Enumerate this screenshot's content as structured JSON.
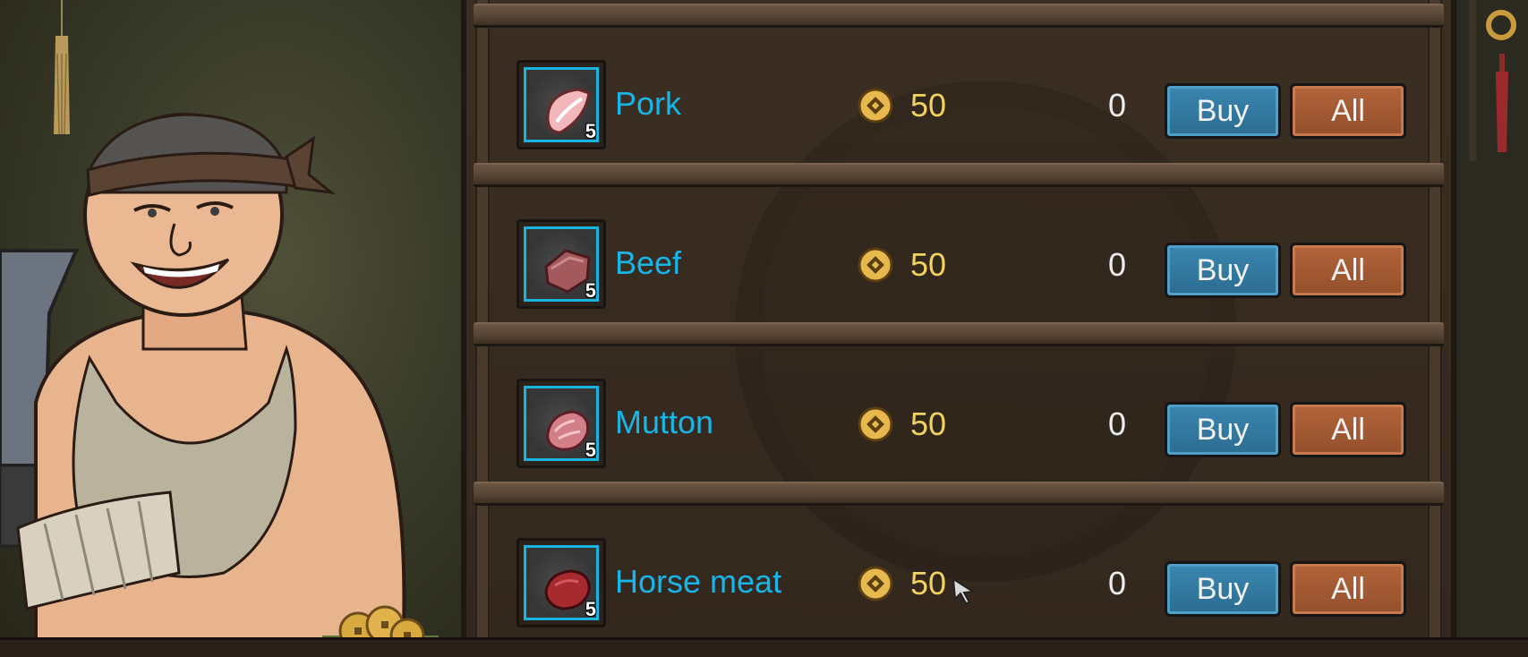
{
  "shop": {
    "items": [
      {
        "name": "Pork",
        "quantity": "5",
        "price": "50",
        "owned": "0",
        "buy_label": "Buy",
        "all_label": "All",
        "icon": "pork-icon",
        "color": "#f1b7ba"
      },
      {
        "name": "Beef",
        "quantity": "5",
        "price": "50",
        "owned": "0",
        "buy_label": "Buy",
        "all_label": "All",
        "icon": "beef-icon",
        "color": "#a4595d"
      },
      {
        "name": "Mutton",
        "quantity": "5",
        "price": "50",
        "owned": "0",
        "buy_label": "Buy",
        "all_label": "All",
        "icon": "mutton-icon",
        "color": "#d37f88"
      },
      {
        "name": "Horse meat",
        "quantity": "5",
        "price": "50",
        "owned": "0",
        "buy_label": "Buy",
        "all_label": "All",
        "icon": "horse-meat-icon",
        "color": "#a72a2f"
      }
    ]
  },
  "colors": {
    "item_name": "#18b5e8",
    "price": "#f2d25e",
    "buy_button": "#2c6c90",
    "all_button": "#92502c"
  }
}
